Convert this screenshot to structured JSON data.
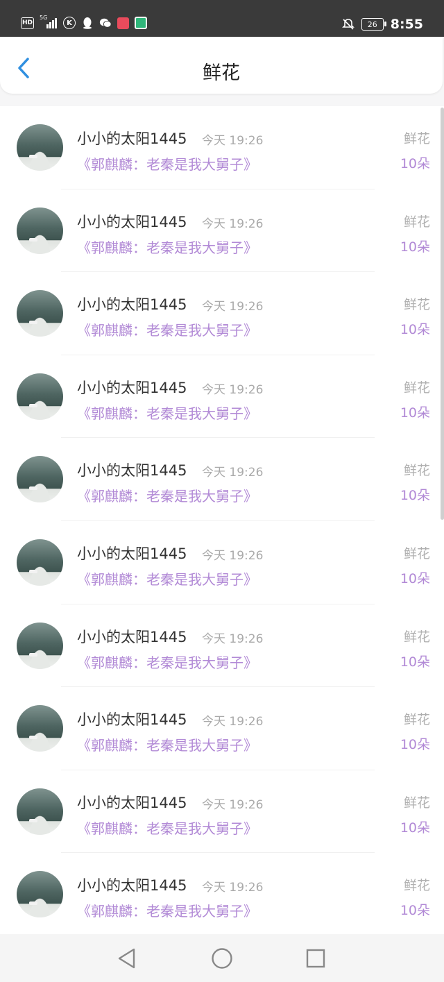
{
  "status_bar": {
    "left_labels": [
      "HD",
      "5G",
      "K"
    ],
    "battery": "26",
    "time": "8:55"
  },
  "header": {
    "title": "鲜花"
  },
  "list": {
    "items": [
      {
        "name": "小小的太阳1445",
        "time": "今天 19:26",
        "work": "《郭麒麟：老秦是我大舅子》",
        "tag": "鲜花",
        "count": "10朵"
      },
      {
        "name": "小小的太阳1445",
        "time": "今天 19:26",
        "work": "《郭麒麟：老秦是我大舅子》",
        "tag": "鲜花",
        "count": "10朵"
      },
      {
        "name": "小小的太阳1445",
        "time": "今天 19:26",
        "work": "《郭麒麟：老秦是我大舅子》",
        "tag": "鲜花",
        "count": "10朵"
      },
      {
        "name": "小小的太阳1445",
        "time": "今天 19:26",
        "work": "《郭麒麟：老秦是我大舅子》",
        "tag": "鲜花",
        "count": "10朵"
      },
      {
        "name": "小小的太阳1445",
        "time": "今天 19:26",
        "work": "《郭麒麟：老秦是我大舅子》",
        "tag": "鲜花",
        "count": "10朵"
      },
      {
        "name": "小小的太阳1445",
        "time": "今天 19:26",
        "work": "《郭麒麟：老秦是我大舅子》",
        "tag": "鲜花",
        "count": "10朵"
      },
      {
        "name": "小小的太阳1445",
        "time": "今天 19:26",
        "work": "《郭麒麟：老秦是我大舅子》",
        "tag": "鲜花",
        "count": "10朵"
      },
      {
        "name": "小小的太阳1445",
        "time": "今天 19:26",
        "work": "《郭麒麟：老秦是我大舅子》",
        "tag": "鲜花",
        "count": "10朵"
      },
      {
        "name": "小小的太阳1445",
        "time": "今天 19:26",
        "work": "《郭麒麟：老秦是我大舅子》",
        "tag": "鲜花",
        "count": "10朵"
      },
      {
        "name": "小小的太阳1445",
        "time": "今天 19:26",
        "work": "《郭麒麟：老秦是我大舅子》",
        "tag": "鲜花",
        "count": "10朵"
      }
    ]
  },
  "colors": {
    "accent": "#2f8fe0",
    "highlight": "#b28ad6",
    "status_bar": "#3a3a3a"
  }
}
